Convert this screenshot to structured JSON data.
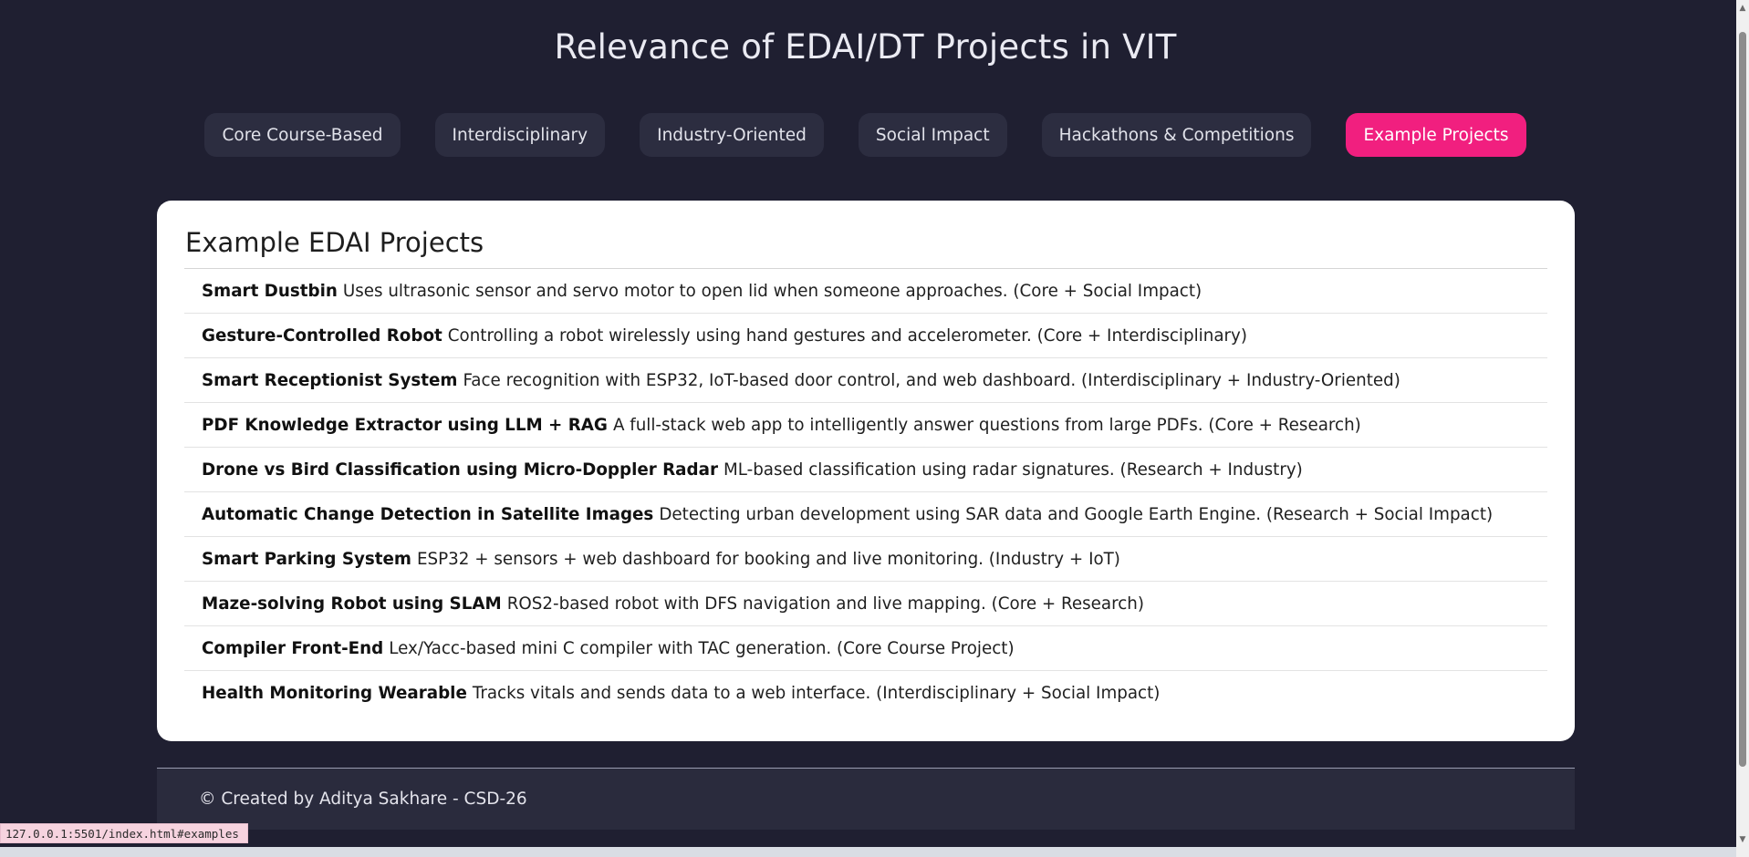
{
  "page": {
    "title": "Relevance of EDAI/DT Projects in VIT"
  },
  "tabs": [
    {
      "label": "Core Course-Based",
      "active": false
    },
    {
      "label": "Interdisciplinary",
      "active": false
    },
    {
      "label": "Industry-Oriented",
      "active": false
    },
    {
      "label": "Social Impact",
      "active": false
    },
    {
      "label": "Hackathons & Competitions",
      "active": false
    },
    {
      "label": "Example Projects",
      "active": true
    }
  ],
  "card": {
    "title": "Example EDAI Projects",
    "projects": [
      {
        "name": "Smart Dustbin",
        "description": "Uses ultrasonic sensor and servo motor to open lid when someone approaches. (Core + Social Impact)"
      },
      {
        "name": "Gesture-Controlled Robot",
        "description": "Controlling a robot wirelessly using hand gestures and accelerometer. (Core + Interdisciplinary)"
      },
      {
        "name": "Smart Receptionist System",
        "description": "Face recognition with ESP32, IoT-based door control, and web dashboard. (Interdisciplinary + Industry-Oriented)"
      },
      {
        "name": "PDF Knowledge Extractor using LLM + RAG",
        "description": "A full-stack web app to intelligently answer questions from large PDFs. (Core + Research)"
      },
      {
        "name": "Drone vs Bird Classification using Micro-Doppler Radar",
        "description": "ML-based classification using radar signatures. (Research + Industry)"
      },
      {
        "name": "Automatic Change Detection in Satellite Images",
        "description": "Detecting urban development using SAR data and Google Earth Engine. (Research + Social Impact)"
      },
      {
        "name": "Smart Parking System",
        "description": "ESP32 + sensors + web dashboard for booking and live monitoring. (Industry + IoT)"
      },
      {
        "name": "Maze-solving Robot using SLAM",
        "description": "ROS2-based robot with DFS navigation and live mapping. (Core + Research)"
      },
      {
        "name": "Compiler Front-End",
        "description": "Lex/Yacc-based mini C compiler with TAC generation. (Core Course Project)"
      },
      {
        "name": "Health Monitoring Wearable",
        "description": "Tracks vitals and sends data to a web interface. (Interdisciplinary + Social Impact)"
      }
    ]
  },
  "footer": {
    "text": "© Created by Aditya Sakhare - CSD-26"
  },
  "browser": {
    "status_url": "127.0.0.1:5501/index.html#examples"
  },
  "colors": {
    "background": "#1f1f31",
    "tab_bg": "#2c2d40",
    "tab_active": "#f11f7f",
    "card_bg": "#ffffff",
    "footer_bg": "#2a2b3d"
  }
}
